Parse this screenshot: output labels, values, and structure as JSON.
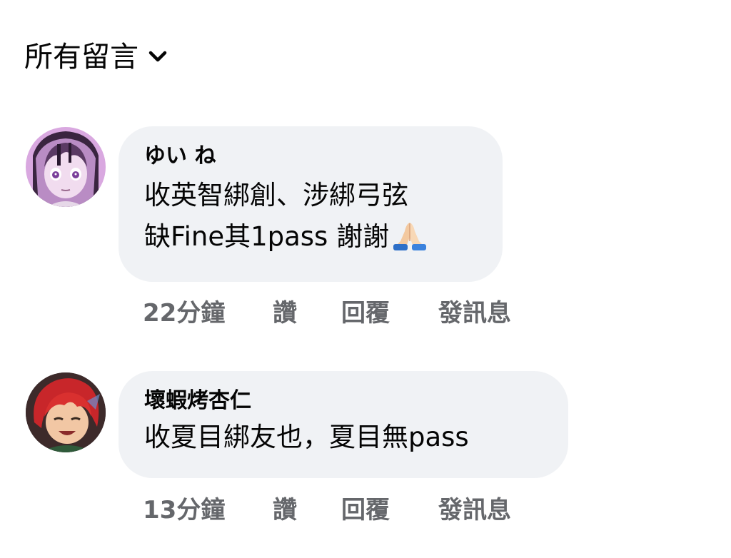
{
  "filter": {
    "label": "所有留言",
    "icon": "chevron-down-icon"
  },
  "comments": [
    {
      "author": "ゆい ね",
      "lines": [
        "收英智綁創、涉綁弓弦",
        "缺Fine其1pass 謝謝"
      ],
      "emoji": "folded-hands-icon",
      "time": "22分鐘",
      "like": "讚",
      "reply": "回覆",
      "message": "發訊息",
      "avatar": "anime-girl-purple-avatar"
    },
    {
      "author": "壞蝦烤杏仁",
      "lines": [
        "收夏目綁友也，夏目無pass"
      ],
      "time": "13分鐘",
      "like": "讚",
      "reply": "回覆",
      "message": "發訊息",
      "avatar": "anime-boy-red-hair-avatar"
    }
  ],
  "colors": {
    "bubble": "#f0f2f5",
    "text": "#050505",
    "secondary": "#65676b"
  }
}
